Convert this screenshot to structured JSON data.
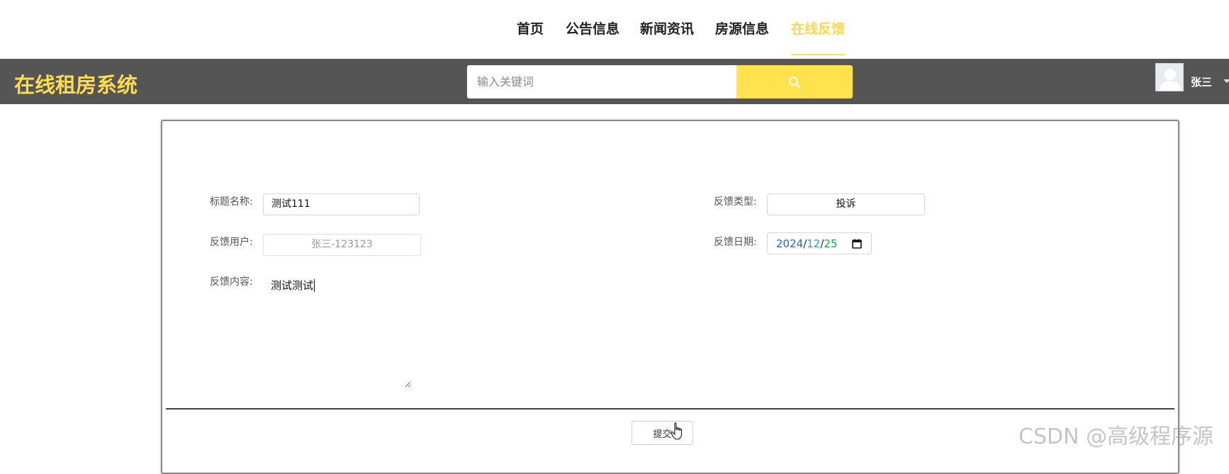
{
  "nav": {
    "items": [
      "首页",
      "公告信息",
      "新闻资讯",
      "房源信息",
      "在线反馈"
    ],
    "active": "在线反馈"
  },
  "header": {
    "logo": "在线租房系统",
    "search_placeholder": "输入关键词",
    "user_name": "张三"
  },
  "form": {
    "title_label": "标题名称:",
    "title_value": "测试111",
    "type_label": "反馈类型:",
    "type_value": "投诉",
    "user_label": "反馈用户:",
    "user_value": "张三-123123",
    "date_label": "反馈日期:",
    "date_year": "2024",
    "date_month": "12",
    "date_day": "25",
    "content_label": "反馈内容:",
    "content_value": "测试测试",
    "submit_label": "提交"
  },
  "watermark": "CSDN @高级程序源",
  "colors": {
    "accent": "#ffe24d",
    "header_bg": "#555555",
    "logo": "#ffdd4a"
  }
}
